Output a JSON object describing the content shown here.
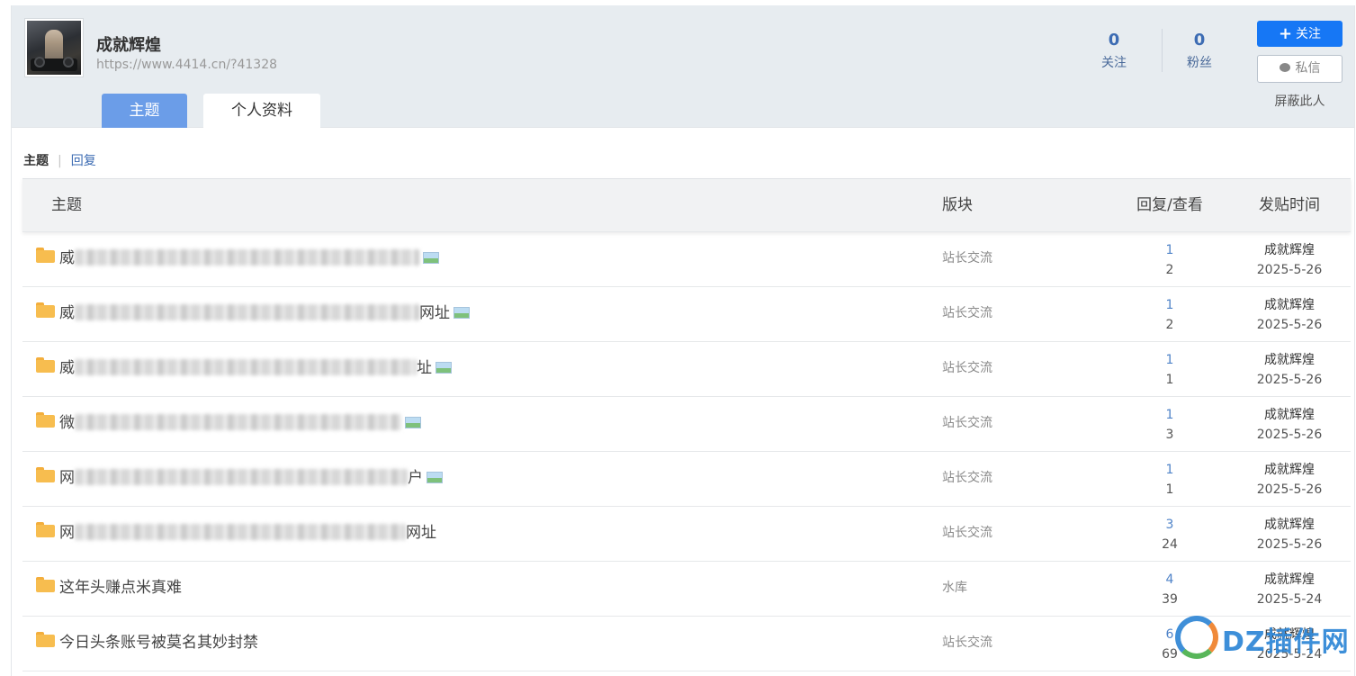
{
  "profile": {
    "username": "成就辉煌",
    "url": "https://www.4414.cn/?41328",
    "stats": [
      {
        "value": "0",
        "label": "关注"
      },
      {
        "value": "0",
        "label": "粉丝"
      }
    ],
    "follow_label": "关注",
    "follow_icon": "plus-icon",
    "message_label": "私信",
    "message_icon": "chat-bubble-icon",
    "block_label": "屏蔽此人"
  },
  "tabs": [
    {
      "label": "主题",
      "active": true
    },
    {
      "label": "个人资料",
      "active": false
    }
  ],
  "subnav": {
    "active": "主题",
    "link": "回复"
  },
  "table": {
    "headers": {
      "topic": "主题",
      "forum": "版块",
      "stats": "回复/查看",
      "time": "发贴时间"
    },
    "rows": [
      {
        "title_start": "威",
        "title_end": "",
        "blurred": true,
        "has_image": true,
        "forum": "站长交流",
        "replies": "1",
        "views": "2",
        "author": "成就辉煌",
        "date": "2025-5-26"
      },
      {
        "title_start": "威",
        "title_end": "网址",
        "blurred": true,
        "has_image": true,
        "forum": "站长交流",
        "replies": "1",
        "views": "2",
        "author": "成就辉煌",
        "date": "2025-5-26"
      },
      {
        "title_start": "威",
        "title_end": "址",
        "blurred": true,
        "has_image": true,
        "forum": "站长交流",
        "replies": "1",
        "views": "1",
        "author": "成就辉煌",
        "date": "2025-5-26"
      },
      {
        "title_start": "微",
        "title_end": "",
        "blurred": true,
        "has_image": true,
        "forum": "站长交流",
        "replies": "1",
        "views": "3",
        "author": "成就辉煌",
        "date": "2025-5-26"
      },
      {
        "title_start": "网",
        "title_end": "户",
        "blurred": true,
        "has_image": true,
        "forum": "站长交流",
        "replies": "1",
        "views": "1",
        "author": "成就辉煌",
        "date": "2025-5-26"
      },
      {
        "title_start": "网",
        "title_end": "网址",
        "blurred": true,
        "has_image": false,
        "forum": "站长交流",
        "replies": "3",
        "views": "24",
        "author": "成就辉煌",
        "date": "2025-5-26"
      },
      {
        "title_start": "这年头赚点米真难",
        "title_end": "",
        "blurred": false,
        "has_image": false,
        "forum": "水库",
        "replies": "4",
        "views": "39",
        "author": "成就辉煌",
        "date": "2025-5-24"
      },
      {
        "title_start": "今日头条账号被莫名其妙封禁",
        "title_end": "",
        "blurred": false,
        "has_image": false,
        "forum": "站长交流",
        "replies": "6",
        "views": "69",
        "author": "成就辉煌",
        "date": "2025-5-24"
      }
    ]
  },
  "watermark": {
    "text": "DZ插件网"
  },
  "colors": {
    "header_bg": "#e7ecf0",
    "accent_blue": "#1677f5",
    "tab_active": "#6b9de8",
    "folder": "#f7bd4f",
    "link": "#3d6cb3"
  }
}
